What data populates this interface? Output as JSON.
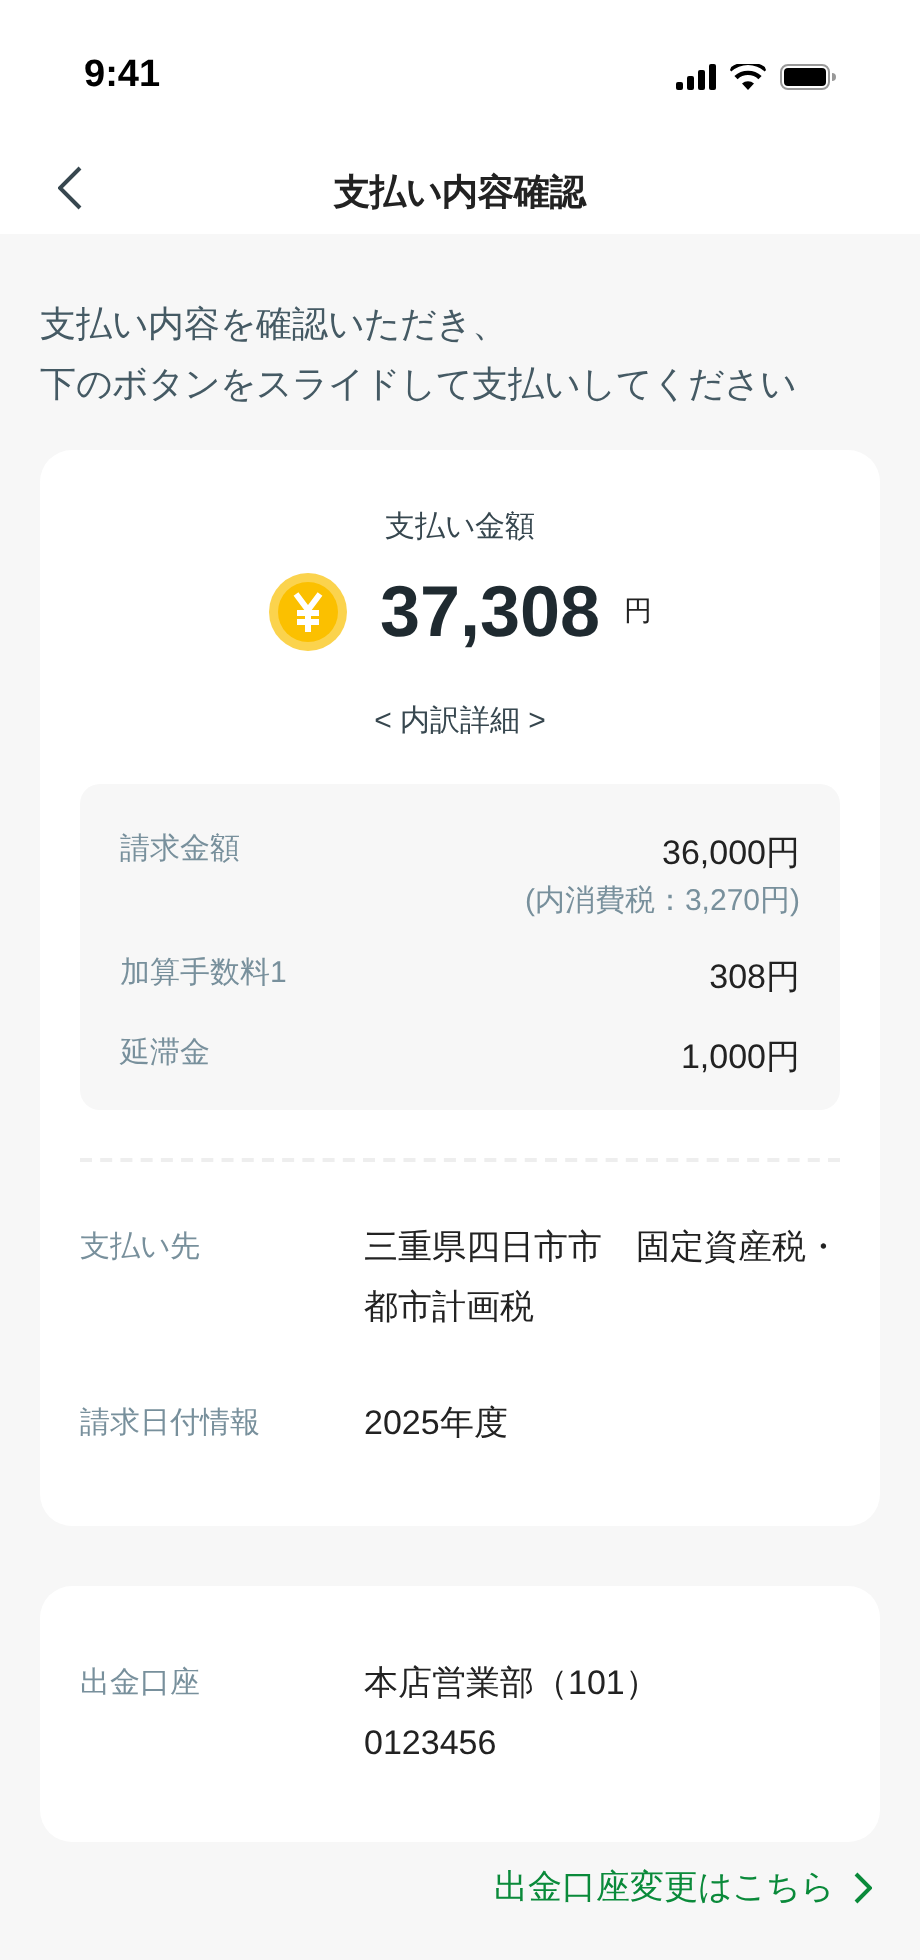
{
  "status_bar": {
    "time": "9:41"
  },
  "header": {
    "title": "支払い内容確認"
  },
  "instruction": [
    "支払い内容を確認いただき、",
    "下のボタンをスライドして支払いしてください"
  ],
  "amount": {
    "label": "支払い金額",
    "value": "37,308",
    "unit": "円",
    "details_link": "< 内訳詳細 >"
  },
  "breakdown": [
    {
      "label": "請求金額",
      "value": "36,000円",
      "note": "(内消費税：3,270円)"
    },
    {
      "label": "加算手数料1",
      "value": "308円"
    },
    {
      "label": "延滞金",
      "value": "1,000円"
    }
  ],
  "info": [
    {
      "label": "支払い先",
      "value": "三重県四日市市　固定資産税・都市計画税"
    },
    {
      "label": "請求日付情報",
      "value": "2025年度"
    }
  ],
  "account": {
    "label": "出金口座",
    "lines": [
      "本店営業部（101）",
      "0123456"
    ]
  },
  "change_link": "出金口座変更はこちら"
}
